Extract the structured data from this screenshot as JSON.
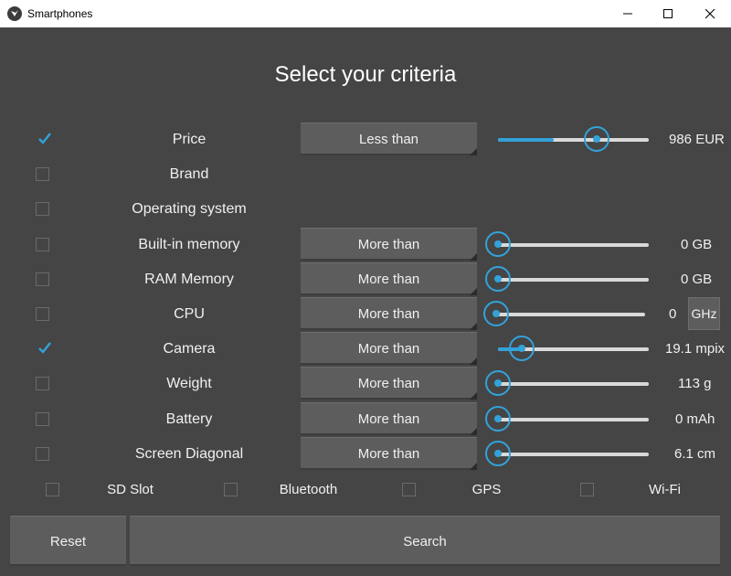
{
  "window": {
    "title": "Smartphones"
  },
  "heading": "Select your criteria",
  "criteria": [
    {
      "key": "price",
      "label": "Price",
      "checked": true,
      "mode": "Less than",
      "value_text": "986 EUR",
      "slider": 0.37
    },
    {
      "key": "brand",
      "label": "Brand",
      "checked": false
    },
    {
      "key": "os",
      "label": "Operating system",
      "checked": false
    },
    {
      "key": "builtin_memory",
      "label": "Built-in memory",
      "checked": false,
      "mode": "More than",
      "value_text": "0 GB",
      "slider": 0.0
    },
    {
      "key": "ram",
      "label": "RAM Memory",
      "checked": false,
      "mode": "More than",
      "value_text": "0 GB",
      "slider": 0.0
    },
    {
      "key": "cpu",
      "label": "CPU",
      "checked": false,
      "mode": "More than",
      "value_text": "0",
      "unit_button": "GHz",
      "slider": 0.0
    },
    {
      "key": "camera",
      "label": "Camera",
      "checked": true,
      "mode": "More than",
      "value_text": "19.1 mpix",
      "slider": 0.16
    },
    {
      "key": "weight",
      "label": "Weight",
      "checked": false,
      "mode": "More than",
      "value_text": "113 g",
      "slider": 0.0
    },
    {
      "key": "battery",
      "label": "Battery",
      "checked": false,
      "mode": "More than",
      "value_text": "0 mAh",
      "slider": 0.0
    },
    {
      "key": "screen_diagonal",
      "label": "Screen Diagonal",
      "checked": false,
      "mode": "More than",
      "value_text": "6.1 cm",
      "slider": 0.0
    }
  ],
  "features": [
    {
      "key": "sd_slot",
      "label": "SD Slot",
      "checked": false
    },
    {
      "key": "bluetooth",
      "label": "Bluetooth",
      "checked": false
    },
    {
      "key": "gps",
      "label": "GPS",
      "checked": false
    },
    {
      "key": "wifi",
      "label": "Wi-Fi",
      "checked": false
    }
  ],
  "buttons": {
    "reset": "Reset",
    "search": "Search"
  },
  "colors": {
    "accent": "#33a2d9",
    "background": "#454545",
    "button": "#5d5d5d"
  }
}
